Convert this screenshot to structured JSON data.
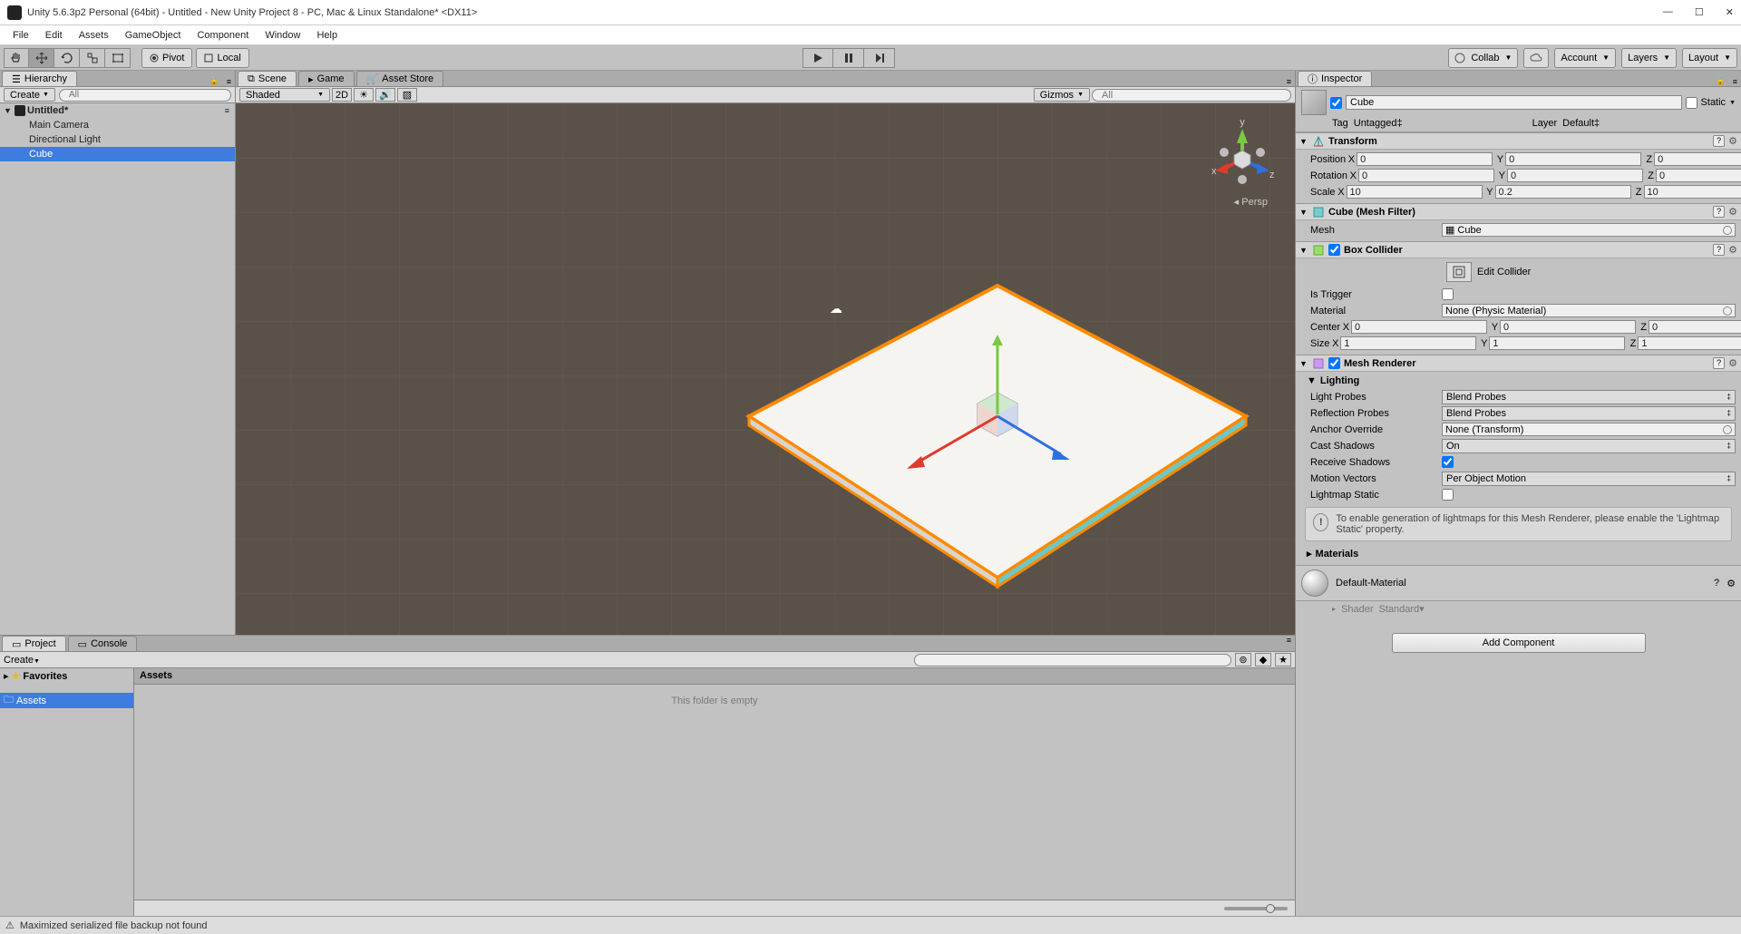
{
  "title": "Unity 5.6.3p2 Personal (64bit) - Untitled - New Unity Project 8 - PC, Mac & Linux Standalone* <DX11>",
  "menus": [
    "File",
    "Edit",
    "Assets",
    "GameObject",
    "Component",
    "Window",
    "Help"
  ],
  "toolbar": {
    "pivot": "Pivot",
    "local": "Local",
    "collab": "Collab",
    "account": "Account",
    "layers": "Layers",
    "layout": "Layout"
  },
  "hierarchy": {
    "title": "Hierarchy",
    "create": "Create",
    "search_ph": "All",
    "scene": "Untitled*",
    "items": [
      "Main Camera",
      "Directional Light",
      "Cube"
    ]
  },
  "scene_tabs": {
    "scene": "Scene",
    "game": "Game",
    "assetstore": "Asset Store"
  },
  "scene_bar": {
    "shading": "Shaded",
    "mode2d": "2D",
    "gizmos": "Gizmos",
    "search_ph": "All"
  },
  "viewport": {
    "persp": "Persp",
    "axes": {
      "x": "x",
      "y": "y",
      "z": "z"
    }
  },
  "project": {
    "tab_project": "Project",
    "tab_console": "Console",
    "create": "Create",
    "favorites": "Favorites",
    "assets": "Assets",
    "path": "Assets",
    "empty": "This folder is empty"
  },
  "status": "Maximized serialized file backup not found",
  "inspector": {
    "title": "Inspector",
    "name": "Cube",
    "static": "Static",
    "tag_lbl": "Tag",
    "tag_val": "Untagged",
    "layer_lbl": "Layer",
    "layer_val": "Default",
    "transform": {
      "title": "Transform",
      "position": "Position",
      "rotation": "Rotation",
      "scale": "Scale",
      "pos": {
        "x": "0",
        "y": "0",
        "z": "0"
      },
      "rot": {
        "x": "0",
        "y": "0",
        "z": "0"
      },
      "scl": {
        "x": "10",
        "y": "0.2",
        "z": "10"
      }
    },
    "meshfilter": {
      "title": "Cube (Mesh Filter)",
      "mesh_lbl": "Mesh",
      "mesh_val": "Cube"
    },
    "boxcollider": {
      "title": "Box Collider",
      "edit": "Edit Collider",
      "istrigger": "Is Trigger",
      "material_lbl": "Material",
      "material_val": "None (Physic Material)",
      "center": "Center",
      "size": "Size",
      "cen": {
        "x": "0",
        "y": "0",
        "z": "0"
      },
      "siz": {
        "x": "1",
        "y": "1",
        "z": "1"
      }
    },
    "meshrenderer": {
      "title": "Mesh Renderer",
      "lighting": "Lighting",
      "lightprobes_lbl": "Light Probes",
      "lightprobes_val": "Blend Probes",
      "reflectionprobes_lbl": "Reflection Probes",
      "reflectionprobes_val": "Blend Probes",
      "anchor_lbl": "Anchor Override",
      "anchor_val": "None (Transform)",
      "castshadows_lbl": "Cast Shadows",
      "castshadows_val": "On",
      "receiveshadows": "Receive Shadows",
      "motionvectors_lbl": "Motion Vectors",
      "motionvectors_val": "Per Object Motion",
      "lightmapstatic": "Lightmap Static",
      "info": "To enable generation of lightmaps for this Mesh Renderer, please enable the 'Lightmap Static' property.",
      "materials": "Materials"
    },
    "material": {
      "name": "Default-Material",
      "shader_lbl": "Shader",
      "shader_val": "Standard"
    },
    "addcomponent": "Add Component"
  }
}
